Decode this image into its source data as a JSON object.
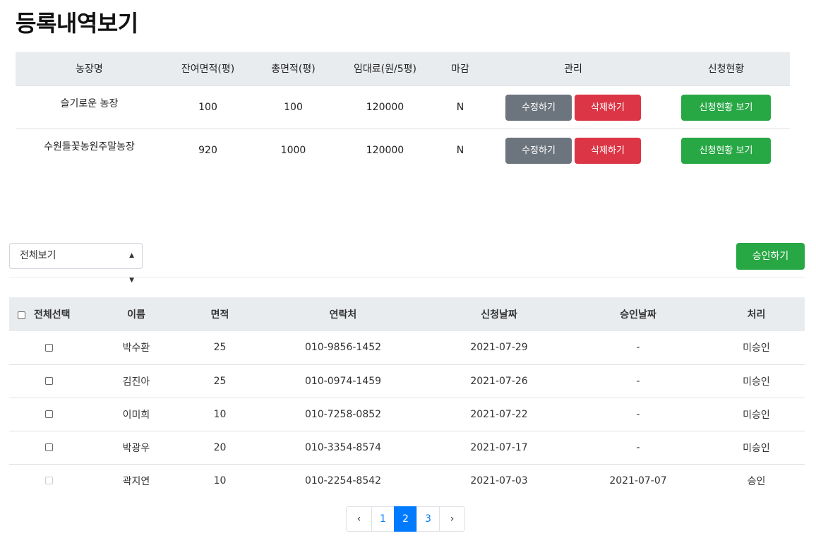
{
  "title": "등록내역보기",
  "farm_table": {
    "headers": [
      "농장명",
      "잔여면적(평)",
      "총면적(평)",
      "임대료(원/5평)",
      "마감",
      "관리",
      "신청현황"
    ],
    "rows": [
      {
        "name": "슬기로운 농장",
        "remaining": "100",
        "total": "100",
        "rent": "120000",
        "closed": "N"
      },
      {
        "name": "수원들꽃농원주말농장",
        "remaining": "920",
        "total": "1000",
        "rent": "120000",
        "closed": "N"
      }
    ],
    "edit_label": "수정하기",
    "delete_label": "삭제하기",
    "status_label": "신청현황 보기"
  },
  "filter": {
    "selected": "전체보기"
  },
  "approve_label": "승인하기",
  "applicants_table": {
    "headers": [
      "전체선택",
      "이름",
      "면적",
      "연락처",
      "신청날짜",
      "승인날짜",
      "처리"
    ],
    "rows": [
      {
        "name": "박수환",
        "area": "25",
        "phone": "010-9856-1452",
        "applied": "2021-07-29",
        "approved": "-",
        "status": "미승인"
      },
      {
        "name": "김진아",
        "area": "25",
        "phone": "010-0974-1459",
        "applied": "2021-07-26",
        "approved": "-",
        "status": "미승인"
      },
      {
        "name": "이미희",
        "area": "10",
        "phone": "010-7258-0852",
        "applied": "2021-07-22",
        "approved": "-",
        "status": "미승인"
      },
      {
        "name": "박광우",
        "area": "20",
        "phone": "010-3354-8574",
        "applied": "2021-07-17",
        "approved": "-",
        "status": "미승인"
      },
      {
        "name": "곽지연",
        "area": "10",
        "phone": "010-2254-8542",
        "applied": "2021-07-03",
        "approved": "2021-07-07",
        "status": "승인"
      }
    ]
  },
  "pagination": {
    "prev": "‹",
    "pages": [
      "1",
      "2",
      "3"
    ],
    "current": "2",
    "next": "›"
  }
}
